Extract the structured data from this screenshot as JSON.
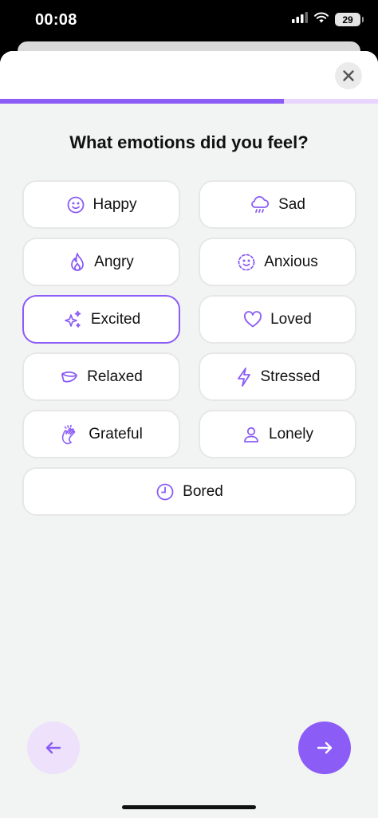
{
  "status_bar": {
    "time": "00:08",
    "battery": "29",
    "icons": [
      "signal-icon",
      "wifi-icon",
      "battery-icon"
    ]
  },
  "progress": {
    "fraction": 0.75
  },
  "question": "What emotions did you feel?",
  "options": [
    {
      "label": "Happy",
      "icon": "smile-icon",
      "selected": false
    },
    {
      "label": "Sad",
      "icon": "rain-cloud-icon",
      "selected": false
    },
    {
      "label": "Angry",
      "icon": "flame-icon",
      "selected": false
    },
    {
      "label": "Anxious",
      "icon": "dashed-smile-icon",
      "selected": false
    },
    {
      "label": "Excited",
      "icon": "sparkles-icon",
      "selected": true
    },
    {
      "label": "Loved",
      "icon": "heart-icon",
      "selected": false
    },
    {
      "label": "Relaxed",
      "icon": "leaf-icon",
      "selected": false
    },
    {
      "label": "Stressed",
      "icon": "lightning-icon",
      "selected": false
    },
    {
      "label": "Grateful",
      "icon": "clapping-hands-icon",
      "selected": false
    },
    {
      "label": "Lonely",
      "icon": "user-icon",
      "selected": false
    },
    {
      "label": "Bored",
      "icon": "clock-icon",
      "selected": false
    }
  ],
  "navigation": {
    "back_icon": "arrow-left-icon",
    "next_icon": "arrow-right-icon",
    "close_icon": "close-icon"
  },
  "colors": {
    "accent": "#8B5CF6",
    "accent_soft": "#E9D5FF",
    "background": "#F2F3F3"
  }
}
